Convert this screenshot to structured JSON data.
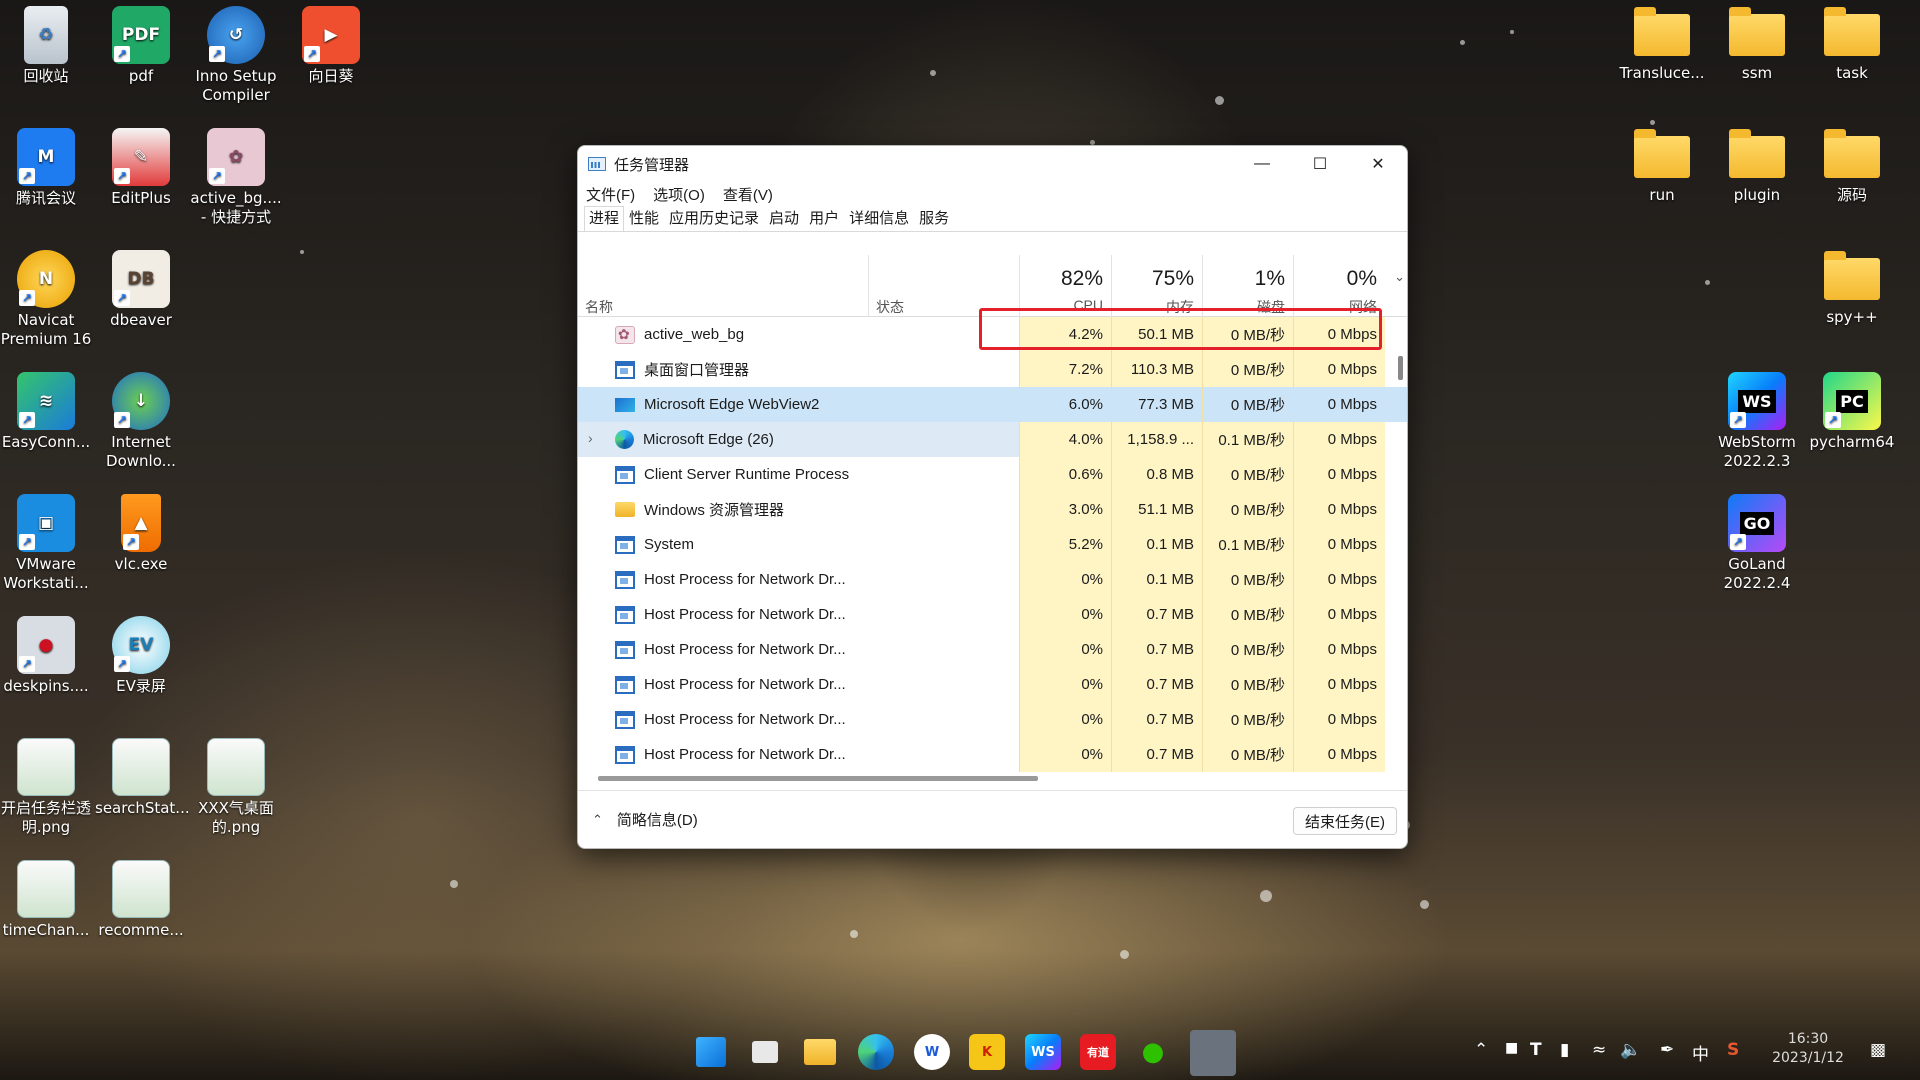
{
  "desktop": {
    "left_icons": [
      {
        "label": "回收站",
        "icon": "recycle-bin-icon"
      },
      {
        "label": "pdf",
        "icon": "pdf-icon"
      },
      {
        "label": "Inno Setup Compiler",
        "icon": "inno-setup-icon"
      },
      {
        "label": "向日葵",
        "icon": "sunlogin-icon"
      },
      {
        "label": "腾讯会议",
        "icon": "tencent-meeting-icon"
      },
      {
        "label": "EditPlus",
        "icon": "editplus-icon"
      },
      {
        "label": "active_bg.... - 快捷方式",
        "icon": "active-bg-icon"
      },
      {
        "label": "Navicat Premium 16",
        "icon": "navicat-icon"
      },
      {
        "label": "dbeaver",
        "icon": "dbeaver-icon"
      },
      {
        "label": "EasyConn...",
        "icon": "easyconnect-icon"
      },
      {
        "label": "Internet Downlo...",
        "icon": "idm-icon"
      },
      {
        "label": "VMware Workstati...",
        "icon": "vmware-icon"
      },
      {
        "label": "vlc.exe",
        "icon": "vlc-icon"
      },
      {
        "label": "deskpins....",
        "icon": "deskpins-icon"
      },
      {
        "label": "EV录屏",
        "icon": "ev-recorder-icon"
      },
      {
        "label": "开启任务栏透明.png",
        "icon": "image-file-icon"
      },
      {
        "label": "searchStat...",
        "icon": "image-file-icon"
      },
      {
        "label": "XXX气桌面的.png",
        "icon": "image-file-icon"
      },
      {
        "label": "timeChan...",
        "icon": "image-file-icon"
      },
      {
        "label": "recomme...",
        "icon": "image-file-icon"
      }
    ],
    "right_icons": [
      {
        "label": "Transluce...",
        "icon": "folder-icon"
      },
      {
        "label": "ssm",
        "icon": "folder-icon"
      },
      {
        "label": "task",
        "icon": "folder-icon"
      },
      {
        "label": "run",
        "icon": "folder-icon"
      },
      {
        "label": "plugin",
        "icon": "folder-icon"
      },
      {
        "label": "源码",
        "icon": "folder-icon"
      },
      {
        "label": "spy++",
        "icon": "folder-icon"
      },
      {
        "label": "WebStorm 2022.2.3",
        "icon": "webstorm-icon",
        "badge": "WS"
      },
      {
        "label": "pycharm64",
        "icon": "pycharm-icon",
        "badge": "PC"
      },
      {
        "label": "GoLand 2022.2.4",
        "icon": "goland-icon",
        "badge": "GO"
      }
    ]
  },
  "task_manager": {
    "title": "任务管理器",
    "controls": {
      "minimize": "—",
      "maximize": "☐",
      "close": "✕"
    },
    "menu": [
      "文件(F)",
      "选项(O)",
      "查看(V)"
    ],
    "tabs": [
      "进程",
      "性能",
      "应用历史记录",
      "启动",
      "用户",
      "详细信息",
      "服务"
    ],
    "active_tab": "进程",
    "columns": {
      "name": "名称",
      "status": "状态",
      "cpu": {
        "percent": "82%",
        "label": "CPU"
      },
      "memory": {
        "percent": "75%",
        "label": "内存"
      },
      "disk": {
        "percent": "1%",
        "label": "磁盘"
      },
      "network": {
        "percent": "0%",
        "label": "网络"
      }
    },
    "processes": [
      {
        "name": "active_web_bg",
        "icon": "active-bg-icon",
        "cpu": "4.2%",
        "mem": "50.1 MB",
        "disk": "0 MB/秒",
        "net": "0 Mbps"
      },
      {
        "name": "桌面窗口管理器",
        "icon": "window-icon",
        "cpu": "7.2%",
        "mem": "110.3 MB",
        "disk": "0 MB/秒",
        "net": "0 Mbps"
      },
      {
        "name": "Microsoft Edge WebView2",
        "icon": "webview2-icon",
        "cpu": "6.0%",
        "mem": "77.3 MB",
        "disk": "0 MB/秒",
        "net": "0 Mbps"
      },
      {
        "name": "Microsoft Edge (26)",
        "icon": "edge-icon",
        "cpu": "4.0%",
        "mem": "1,158.9 ...",
        "disk": "0.1 MB/秒",
        "net": "0 Mbps"
      },
      {
        "name": "Client Server Runtime Process",
        "icon": "window-icon",
        "cpu": "0.6%",
        "mem": "0.8 MB",
        "disk": "0 MB/秒",
        "net": "0 Mbps"
      },
      {
        "name": "Windows 资源管理器",
        "icon": "folder-icon",
        "cpu": "3.0%",
        "mem": "51.1 MB",
        "disk": "0 MB/秒",
        "net": "0 Mbps"
      },
      {
        "name": "System",
        "icon": "window-icon",
        "cpu": "5.2%",
        "mem": "0.1 MB",
        "disk": "0.1 MB/秒",
        "net": "0 Mbps"
      },
      {
        "name": "Host Process for Network Dr...",
        "icon": "window-icon",
        "cpu": "0%",
        "mem": "0.1 MB",
        "disk": "0 MB/秒",
        "net": "0 Mbps"
      },
      {
        "name": "Host Process for Network Dr...",
        "icon": "window-icon",
        "cpu": "0%",
        "mem": "0.7 MB",
        "disk": "0 MB/秒",
        "net": "0 Mbps"
      },
      {
        "name": "Host Process for Network Dr...",
        "icon": "window-icon",
        "cpu": "0%",
        "mem": "0.7 MB",
        "disk": "0 MB/秒",
        "net": "0 Mbps"
      },
      {
        "name": "Host Process for Network Dr...",
        "icon": "window-icon",
        "cpu": "0%",
        "mem": "0.7 MB",
        "disk": "0 MB/秒",
        "net": "0 Mbps"
      },
      {
        "name": "Host Process for Network Dr...",
        "icon": "window-icon",
        "cpu": "0%",
        "mem": "0.7 MB",
        "disk": "0 MB/秒",
        "net": "0 Mbps"
      },
      {
        "name": "Host Process for Network Dr...",
        "icon": "window-icon",
        "cpu": "0%",
        "mem": "0.7 MB",
        "disk": "0 MB/秒",
        "net": "0 Mbps"
      }
    ],
    "footer": {
      "summary": "简略信息(D)",
      "end_task": "结束任务(E)"
    },
    "colors": {
      "usage_cell": "#fff4c4",
      "selected_row": "#cce4f7",
      "highlight_box": "#e4212a"
    }
  },
  "taskbar": {
    "apps": [
      {
        "name": "start",
        "icon": "windows-start-icon"
      },
      {
        "name": "task-view",
        "icon": "task-view-icon"
      },
      {
        "name": "file-explorer",
        "icon": "file-explorer-icon"
      },
      {
        "name": "edge",
        "icon": "edge-icon"
      },
      {
        "name": "wps",
        "icon": "wps-icon"
      },
      {
        "name": "kugou",
        "icon": "kugou-icon"
      },
      {
        "name": "webstorm",
        "icon": "webstorm-icon",
        "badge": "WS"
      },
      {
        "name": "youdao",
        "icon": "youdao-icon",
        "badge": "有道"
      },
      {
        "name": "wechat",
        "icon": "wechat-icon"
      },
      {
        "name": "task-manager",
        "icon": "task-manager-icon"
      }
    ],
    "tray": {
      "ime": "中",
      "time": "16:30",
      "date": "2023/1/12"
    }
  }
}
